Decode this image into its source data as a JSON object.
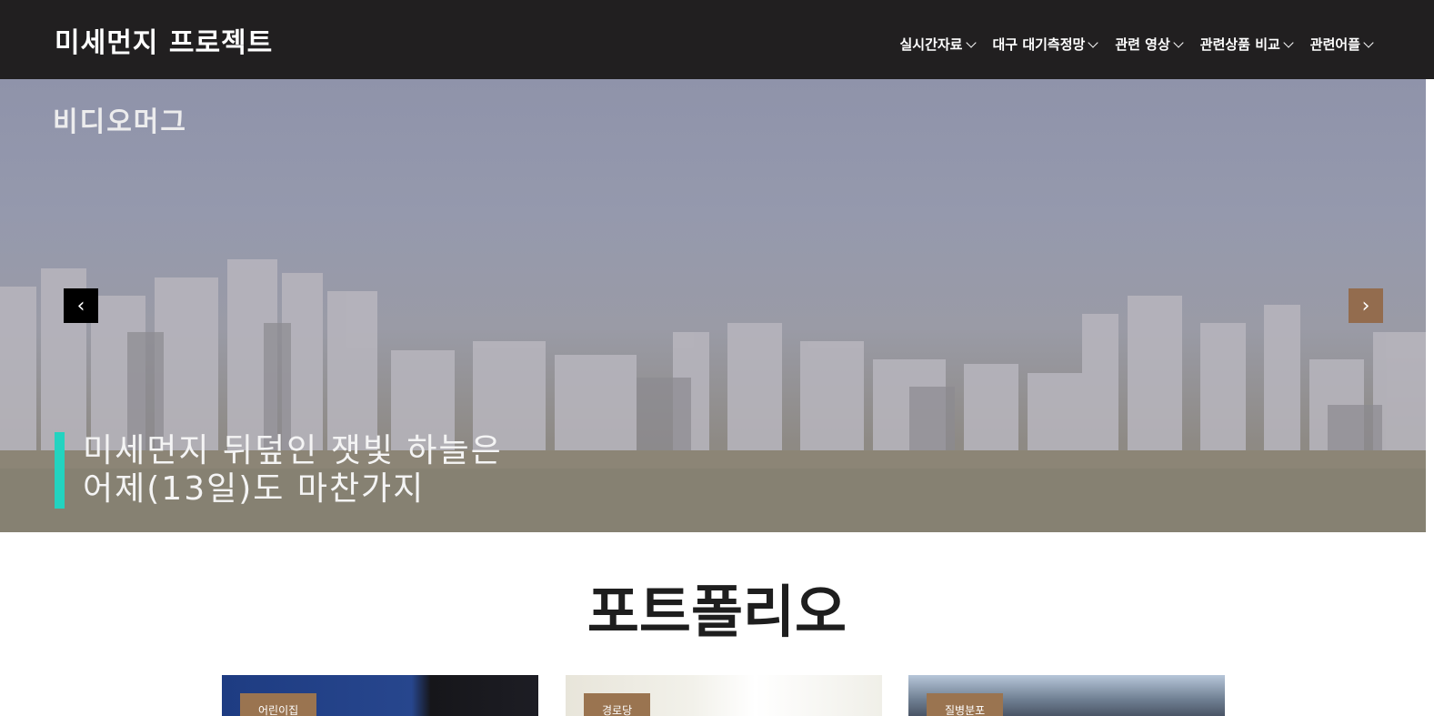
{
  "header": {
    "brand": "미세먼지 프로젝트",
    "menu": [
      {
        "label": "실시간자료"
      },
      {
        "label": "대구 대기측정망"
      },
      {
        "label": "관련 영상"
      },
      {
        "label": "관련상품 비교"
      },
      {
        "label": "관련어플"
      }
    ]
  },
  "hero": {
    "watermark": "비디오머그",
    "caption_line1": "미세먼지 뒤덮인 잿빛 하늘은",
    "caption_line2": "어제(13일)도 마찬가지",
    "prev_icon": "‹",
    "next_icon": "›"
  },
  "portfolio": {
    "title": "포트폴리오",
    "cards": [
      {
        "tag": "어린이집"
      },
      {
        "tag": "경로당"
      },
      {
        "tag": "질병분포"
      }
    ]
  },
  "colors": {
    "nav_bg": "#211f20",
    "accent_brown": "#936c4e",
    "caption_bar": "#23d3c0"
  }
}
